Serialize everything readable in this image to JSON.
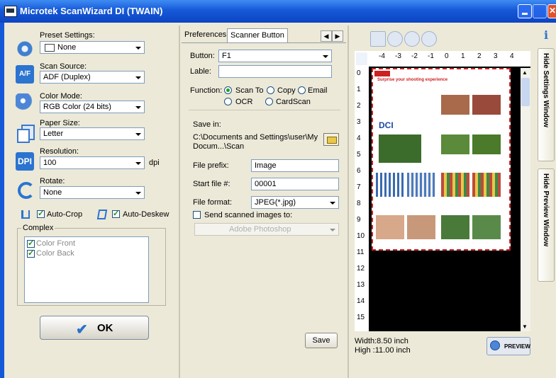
{
  "window": {
    "title": "Microtek ScanWizard DI (TWAIN)"
  },
  "settings": {
    "preset_label": "Preset Settings:",
    "preset_value": "None",
    "source_label": "Scan Source:",
    "source_value": "ADF (Duplex)",
    "color_label": "Color Mode:",
    "color_value": "RGB Color (24 bits)",
    "paper_label": "Paper Size:",
    "paper_value": "Letter",
    "resolution_label": "Resolution:",
    "resolution_value": "100",
    "resolution_unit": "dpi",
    "rotate_label": "Rotate:",
    "rotate_value": "None",
    "autocrop_label": "Auto-Crop",
    "autodeskew_label": "Auto-Deskew",
    "complex_label": "Complex",
    "complex_items": [
      "Color Front",
      "Color Back"
    ],
    "ok_label": "OK"
  },
  "tabs": [
    "Preferences",
    "Scanner Button"
  ],
  "scanner_button": {
    "button_label": "Button:",
    "button_value": "F1",
    "lable_label": "Lable:",
    "lable_value": "",
    "function_label": "Function:",
    "functions": [
      "Scan To",
      "Copy",
      "Email",
      "OCR",
      "CardScan"
    ],
    "save_in_label": "Save in:",
    "save_path_1": "C:\\Documents and Settings\\user\\My",
    "save_path_2": "Docum...\\Scan",
    "prefix_label": "File prefix:",
    "prefix_value": "Image",
    "start_label": "Start file #:",
    "start_value": "00001",
    "format_label": "File format:",
    "format_value": "JPEG(*.jpg)",
    "send_label": "Send scanned images to:",
    "send_value": "Adobe Photoshop",
    "save_button": "Save"
  },
  "preview": {
    "ruler_top": [
      "-4",
      "-3",
      "-2",
      "-1",
      "0",
      "1",
      "2",
      "3",
      "4"
    ],
    "ruler_left": [
      "0",
      "1",
      "2",
      "3",
      "4",
      "5",
      "6",
      "7",
      "8",
      "9",
      "10",
      "11",
      "12",
      "13",
      "14",
      "15"
    ],
    "doc_header": "Surprise your shooting experience",
    "doc_logo": "DCI",
    "width_text": "Width:8.50 inch",
    "height_text": "High :11.00 inch",
    "preview_button": "PREVIEW"
  },
  "side_tabs": [
    "Hide Settings Window",
    "Hide Preview Window"
  ],
  "colors": {
    "title_bar": "#1659d8",
    "accent": "#2b74d0",
    "frame_border": "#c22222"
  }
}
